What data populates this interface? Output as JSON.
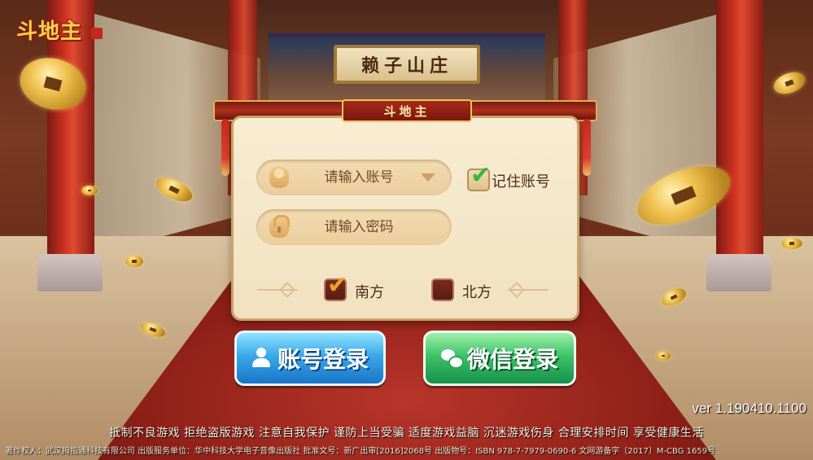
{
  "logo": {
    "text": "斗地主"
  },
  "scene": {
    "plaque_text": "赖子山庄"
  },
  "panel": {
    "title": "斗地主",
    "account_field": {
      "placeholder": "请输入账号"
    },
    "password_field": {
      "placeholder": "请输入密码"
    },
    "remember": {
      "label": "记住账号",
      "checked": true
    },
    "regions": [
      {
        "label": "南方",
        "checked": true
      },
      {
        "label": "北方",
        "checked": false
      }
    ]
  },
  "buttons": {
    "account_login": "账号登录",
    "wechat_login": "微信登录"
  },
  "footer": {
    "version": "ver 1.190410.1100",
    "advisory": "抵制不良游戏 拒绝盗版游戏 注意自我保护 谨防上当受骗 适度游戏益脑 沉迷游戏伤身 合理安排时间 享受健康生活",
    "copyright": "著作权人：武汉拇指通科技有限公司 出版服务单位：华中科技大学电子音像出版社 批准文号：新广出审[2016]2068号 出版物号：ISBN 978-7-7979-0690-6 文网游备字〔2017〕M-CBG 1659号"
  },
  "colors": {
    "panel_bg": "#f1e1c0",
    "check_green": "#3ab83a",
    "check_orange": "#f0a020",
    "account_button": "#2a8ed8",
    "wechat_button": "#2aa85a"
  }
}
